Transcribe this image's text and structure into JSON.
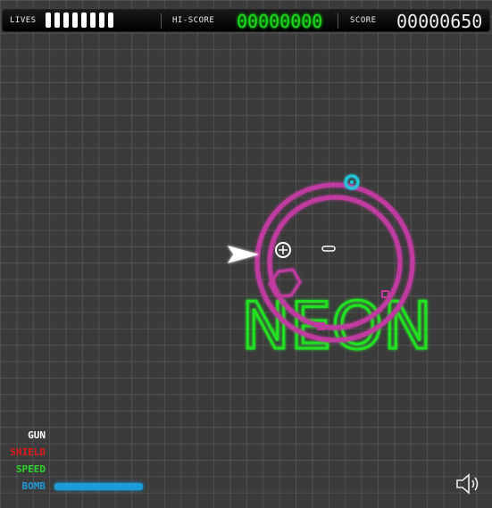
{
  "hud": {
    "lives_label": "LIVES",
    "lives_count": 8,
    "hiscore_label": "HI-SCORE",
    "hiscore_value": "00000000",
    "score_label": "SCORE",
    "score_value": "00000650"
  },
  "powerups": {
    "gun_label": "GUN",
    "shield_label": "SHIELD",
    "speed_label": "SPEED",
    "bomb_label": "BOMB",
    "bomb_level": 1.0
  },
  "playfield": {
    "logo_text": "NEON"
  },
  "icons": {
    "sound": "speaker-icon",
    "player": "player-ship-icon",
    "crosshair": "crosshair-icon"
  },
  "colors": {
    "hiscore": "#1fd81f",
    "logo": "#22e022",
    "ring": "#c03aa0",
    "gun": "#ffffff",
    "shield": "#e01818",
    "speed": "#28d828",
    "bomb": "#1b9bd8",
    "enemy_cyan": "#20c8d8"
  }
}
